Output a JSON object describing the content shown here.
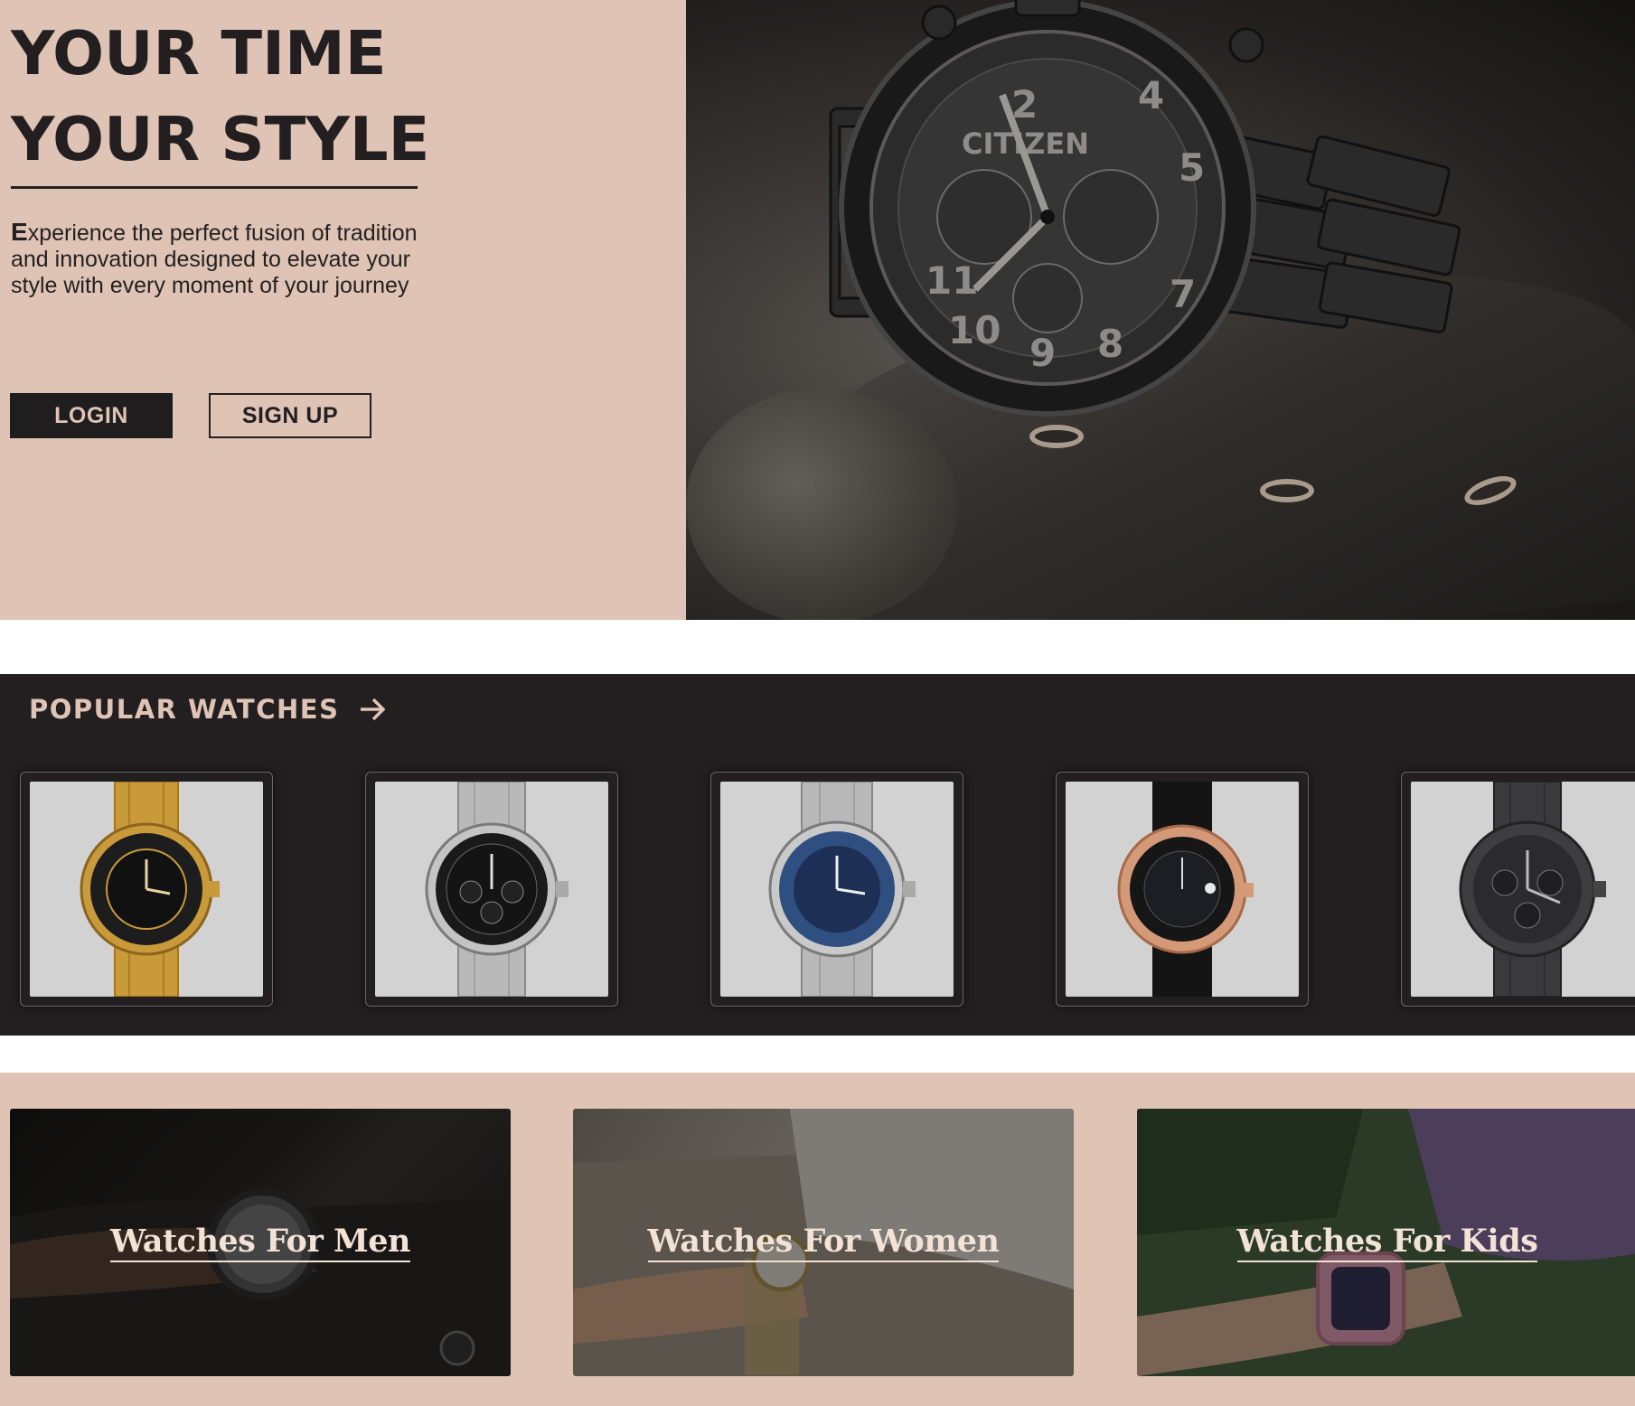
{
  "hero": {
    "title_line1": "YOUR TIME",
    "title_line2": "YOUR STYLE",
    "description_first": "E",
    "description_rest": "xperience the perfect fusion of tradition and innovation designed to elevate your style with every moment of your journey",
    "login_label": "LOGIN",
    "signup_label": "SIGN UP",
    "image": "watch-on-jacket-photo"
  },
  "popular": {
    "title": "POPULAR WATCHES",
    "arrow_icon": "arrow-right-icon",
    "cards": [
      {
        "image": "gold-diver-watch"
      },
      {
        "image": "steel-chronograph-watch"
      },
      {
        "image": "blue-bezel-diver-watch"
      },
      {
        "image": "rose-gold-skymoon-watch"
      },
      {
        "image": "black-chronograph-watch"
      }
    ]
  },
  "categories": [
    {
      "label": "Watches For Men"
    },
    {
      "label": "Watches For Women"
    },
    {
      "label": "Watches For Kids"
    }
  ],
  "colors": {
    "beige": "#dfc4b5",
    "dark": "#231f20",
    "text_on_dark": "#f3e3d6"
  }
}
